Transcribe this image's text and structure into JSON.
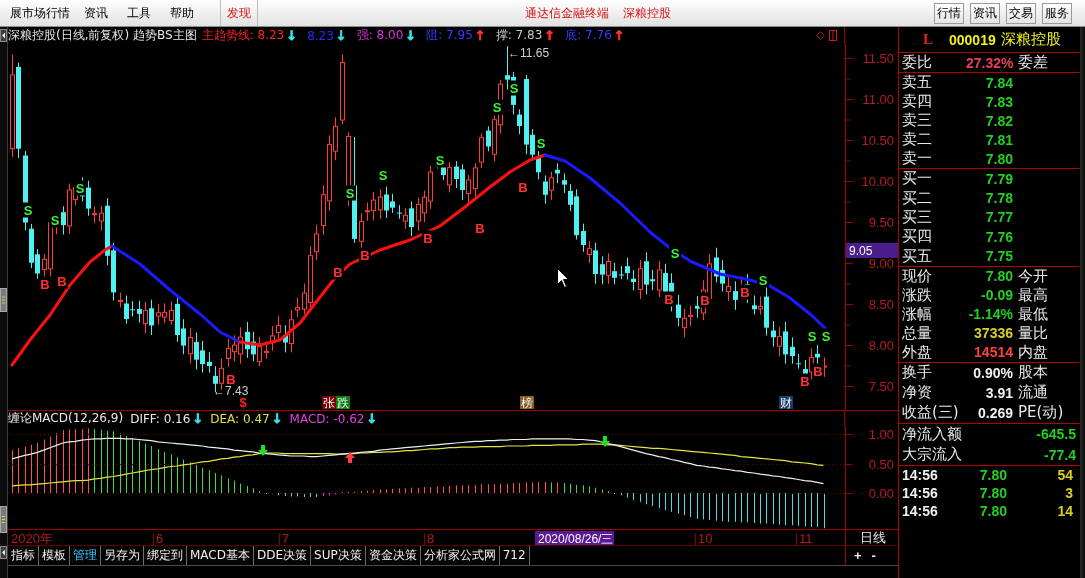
{
  "menubar": {
    "items": [
      {
        "label": "展市场行情"
      },
      {
        "label": "资讯"
      },
      {
        "label": "工具"
      },
      {
        "label": "帮助"
      }
    ],
    "discover": "发现",
    "brand": "通达信金融终端",
    "stock": "深粮控股",
    "buttons": [
      "行情",
      "资讯",
      "交易",
      "服务"
    ]
  },
  "chart_header": {
    "title": "深粮控股(日线,前复权) 趋势BS主图",
    "indicators": [
      {
        "text": "主趋势线: 8.23",
        "color": "#ff2020",
        "arrow": {
          "text": "↓",
          "color": "#38e8f0"
        }
      },
      {
        "text": "8.23",
        "color": "#2a2aff",
        "arrow": {
          "text": "↓",
          "color": "#38e8f0"
        }
      },
      {
        "text": "强: 8.00",
        "color": "#e030e0",
        "arrow": {
          "text": "↓",
          "color": "#38e8f0"
        }
      },
      {
        "text": "阻: 7.95",
        "color": "#3a3aff",
        "arrow": {
          "text": "↑",
          "color": "#ff3030"
        }
      },
      {
        "text": "撑: 7.83",
        "color": "#c8c8c8",
        "arrow": {
          "text": "↑",
          "color": "#ff3030"
        }
      },
      {
        "text": "底: 7.76",
        "color": "#3a3aff",
        "arrow": {
          "text": "↑",
          "color": "#ff3030"
        }
      }
    ]
  },
  "price_chart": {
    "axis_labels": [
      "11.50",
      "11.00",
      "10.50",
      "10.00",
      "9.50",
      "9.00",
      "8.50",
      "8.00",
      "7.50"
    ],
    "cursor_price": "9.05",
    "high_label": "←11.65",
    "low_label": "←7.43",
    "signals": [
      {
        "label": "S",
        "kind": "sell"
      },
      {
        "label": "B",
        "kind": "buy"
      },
      {
        "label": "S",
        "kind": "sell"
      },
      {
        "label": "B",
        "kind": "buy"
      },
      {
        "label": "S",
        "kind": "sell"
      },
      {
        "label": "B",
        "kind": "buy"
      },
      {
        "label": "B",
        "kind": "buy"
      },
      {
        "label": "S",
        "kind": "sell"
      },
      {
        "label": "B",
        "kind": "buy"
      },
      {
        "label": "S",
        "kind": "sell"
      },
      {
        "label": "B",
        "kind": "buy"
      },
      {
        "label": "S",
        "kind": "sell"
      },
      {
        "label": "B",
        "kind": "buy"
      },
      {
        "label": "S",
        "kind": "sell"
      },
      {
        "label": "S",
        "kind": "sell"
      },
      {
        "label": "B",
        "kind": "buy"
      },
      {
        "label": "S",
        "kind": "sell"
      },
      {
        "label": "B",
        "kind": "buy"
      },
      {
        "label": "S",
        "kind": "sell"
      },
      {
        "label": "B",
        "kind": "buy"
      },
      {
        "label": "B",
        "kind": "buy"
      },
      {
        "label": "S",
        "kind": "sell"
      },
      {
        "label": "B",
        "kind": "buy"
      },
      {
        "label": "S",
        "kind": "sell"
      },
      {
        "label": "B",
        "kind": "buy"
      },
      {
        "label": "S",
        "kind": "sell"
      }
    ],
    "events": [
      {
        "label": "$",
        "kind": "plain",
        "color": "#ff2020"
      },
      {
        "label": "张",
        "kind": "tag",
        "color": "#7a0000"
      },
      {
        "label": "跌",
        "kind": "tag",
        "color": "#0e800e"
      },
      {
        "label": "榜",
        "kind": "tag",
        "color": "#8a5a20"
      },
      {
        "label": "财",
        "kind": "tag",
        "color": "#1c3a6a"
      }
    ]
  },
  "macd_panel": {
    "title": "缠论MACD(12,26,9)",
    "values": [
      {
        "text": "DIFF: 0.16",
        "color": "#e8e8e8",
        "arrow": {
          "text": "↓",
          "color": "#38e8f0"
        }
      },
      {
        "text": "DEA: 0.47",
        "color": "#e0e040",
        "arrow": {
          "text": "↓",
          "color": "#38e8f0"
        }
      },
      {
        "text": "MACD: -0.62",
        "color": "#e040e0",
        "arrow": {
          "text": "↓",
          "color": "#38e8f0"
        }
      }
    ],
    "chart_data": {
      "type": "line",
      "grid": true,
      "ylim": [
        -0.63,
        1.14
      ],
      "yticks": [
        {
          "value": 1,
          "label": "1.00"
        },
        {
          "value": 0.5,
          "label": "0.50"
        },
        {
          "value": 0,
          "label": "0.00"
        }
      ],
      "series": [
        {
          "color": "#eeeeee",
          "values": [
            0.58,
            0.61,
            0.64,
            0.66,
            0.69,
            0.73,
            0.77,
            0.81,
            0.85,
            0.87,
            0.88,
            0.9,
            0.91,
            0.92,
            0.92,
            0.93,
            0.93,
            0.93,
            0.92,
            0.92,
            0.91,
            0.9,
            0.89,
            0.87,
            0.86,
            0.85,
            0.84,
            0.83,
            0.82,
            0.81,
            0.8,
            0.78,
            0.77,
            0.76,
            0.75,
            0.73,
            0.72,
            0.71,
            0.7,
            0.68,
            0.67,
            0.66,
            0.65,
            0.64,
            0.63,
            0.63,
            0.63,
            0.62,
            0.62,
            0.63,
            0.64,
            0.65,
            0.66,
            0.67,
            0.68,
            0.69,
            0.7,
            0.71,
            0.73,
            0.74,
            0.75,
            0.76,
            0.77,
            0.78,
            0.79,
            0.8,
            0.81,
            0.82,
            0.83,
            0.84,
            0.85,
            0.86,
            0.87,
            0.88,
            0.88,
            0.89,
            0.89,
            0.9,
            0.9,
            0.91,
            0.91,
            0.91,
            0.92,
            0.92,
            0.92,
            0.92,
            0.92,
            0.92,
            0.92,
            0.91,
            0.91,
            0.9,
            0.89,
            0.87,
            0.84,
            0.82,
            0.79,
            0.76,
            0.73,
            0.7,
            0.67,
            0.65,
            0.62,
            0.6,
            0.57,
            0.55,
            0.52,
            0.5,
            0.47,
            0.46,
            0.44,
            0.43,
            0.41,
            0.4,
            0.38,
            0.37,
            0.35,
            0.34,
            0.32,
            0.31,
            0.29,
            0.28,
            0.26,
            0.25,
            0.23,
            0.21,
            0.2,
            0.18,
            0.16
          ]
        },
        {
          "color": "#e4e440",
          "values": [
            0.12,
            0.13,
            0.14,
            0.14,
            0.15,
            0.16,
            0.17,
            0.18,
            0.19,
            0.2,
            0.21,
            0.21,
            0.22,
            0.24,
            0.25,
            0.27,
            0.28,
            0.3,
            0.32,
            0.34,
            0.36,
            0.38,
            0.4,
            0.41,
            0.43,
            0.45,
            0.46,
            0.48,
            0.49,
            0.51,
            0.53,
            0.54,
            0.56,
            0.58,
            0.59,
            0.61,
            0.62,
            0.64,
            0.65,
            0.67,
            0.68,
            0.68,
            0.68,
            0.67,
            0.67,
            0.67,
            0.67,
            0.67,
            0.67,
            0.67,
            0.67,
            0.66,
            0.66,
            0.67,
            0.67,
            0.68,
            0.68,
            0.69,
            0.69,
            0.7,
            0.7,
            0.71,
            0.72,
            0.72,
            0.73,
            0.74,
            0.75,
            0.75,
            0.76,
            0.77,
            0.77,
            0.78,
            0.78,
            0.78,
            0.79,
            0.79,
            0.79,
            0.79,
            0.8,
            0.8,
            0.8,
            0.8,
            0.81,
            0.81,
            0.81,
            0.81,
            0.82,
            0.82,
            0.82,
            0.82,
            0.83,
            0.83,
            0.83,
            0.83,
            0.82,
            0.82,
            0.81,
            0.8,
            0.79,
            0.78,
            0.77,
            0.76,
            0.76,
            0.75,
            0.74,
            0.73,
            0.72,
            0.71,
            0.7,
            0.69,
            0.68,
            0.67,
            0.66,
            0.65,
            0.64,
            0.62,
            0.61,
            0.6,
            0.59,
            0.58,
            0.57,
            0.56,
            0.55,
            0.53,
            0.52,
            0.51,
            0.5,
            0.48,
            0.47
          ]
        }
      ]
    }
  },
  "date_axis": {
    "labels": [
      "2020年",
      "6",
      "7",
      "8",
      "10",
      "11"
    ],
    "cursor_date": "2020/08/26/三",
    "period_button": "日线"
  },
  "bottom_tabs": [
    {
      "label": "指标",
      "selected": false
    },
    {
      "label": "模板",
      "selected": false
    },
    {
      "label": "管理",
      "selected": true
    },
    {
      "label": "另存为",
      "selected": false
    },
    {
      "label": "绑定到",
      "selected": false
    },
    {
      "label": "MACD基本",
      "selected": false
    },
    {
      "label": "DDE决策",
      "selected": false
    },
    {
      "label": "SUP决策",
      "selected": false
    },
    {
      "label": "资金决策",
      "selected": false
    },
    {
      "label": "分析家公式网",
      "selected": false
    },
    {
      "label": "712",
      "selected": false
    }
  ],
  "zoom_buttons": [
    "+",
    "-"
  ],
  "quote_panel": {
    "market_flag": "L",
    "code": "000019",
    "name": "深粮控股",
    "order_ratio": {
      "label": "委比",
      "value": "27.32%",
      "label2": "委差"
    },
    "asks": [
      {
        "label": "卖五",
        "price": "7.84"
      },
      {
        "label": "卖四",
        "price": "7.83"
      },
      {
        "label": "卖三",
        "price": "7.82"
      },
      {
        "label": "卖二",
        "price": "7.81"
      },
      {
        "label": "卖一",
        "price": "7.80"
      }
    ],
    "bids": [
      {
        "label": "买一",
        "price": "7.79"
      },
      {
        "label": "买二",
        "price": "7.78"
      },
      {
        "label": "买三",
        "price": "7.77"
      },
      {
        "label": "买四",
        "price": "7.76"
      },
      {
        "label": "买五",
        "price": "7.75"
      }
    ],
    "quote_stats": [
      {
        "label": "现价",
        "value": "7.80",
        "color": "#22d022",
        "label2": "今开"
      },
      {
        "label": "涨跌",
        "value": "-0.09",
        "color": "#22d022",
        "label2": "最高"
      },
      {
        "label": "涨幅",
        "value": "-1.14%",
        "color": "#22d022",
        "label2": "最低"
      },
      {
        "label": "总量",
        "value": "37336",
        "color": "#d8d020",
        "label2": "量比"
      },
      {
        "label": "外盘",
        "value": "14514",
        "color": "#ff4040",
        "label2": "内盘"
      }
    ],
    "share_stats": [
      {
        "label": "换手",
        "value": "0.90%",
        "label2": "股本"
      },
      {
        "label": "净资",
        "value": "3.91",
        "label2": "流通"
      },
      {
        "label": "收益(三)",
        "value": "0.269",
        "label2": "PE(动)"
      }
    ],
    "fund_flows": [
      {
        "label": "净流入额",
        "value": "-645.5"
      },
      {
        "label": "大宗流入",
        "value": "-77.4"
      }
    ],
    "ticks": [
      {
        "time": "14:56",
        "price": "7.80",
        "volume": "54"
      },
      {
        "time": "14:56",
        "price": "7.80",
        "volume": "3"
      },
      {
        "time": "14:56",
        "price": "7.80",
        "volume": "14"
      }
    ]
  }
}
